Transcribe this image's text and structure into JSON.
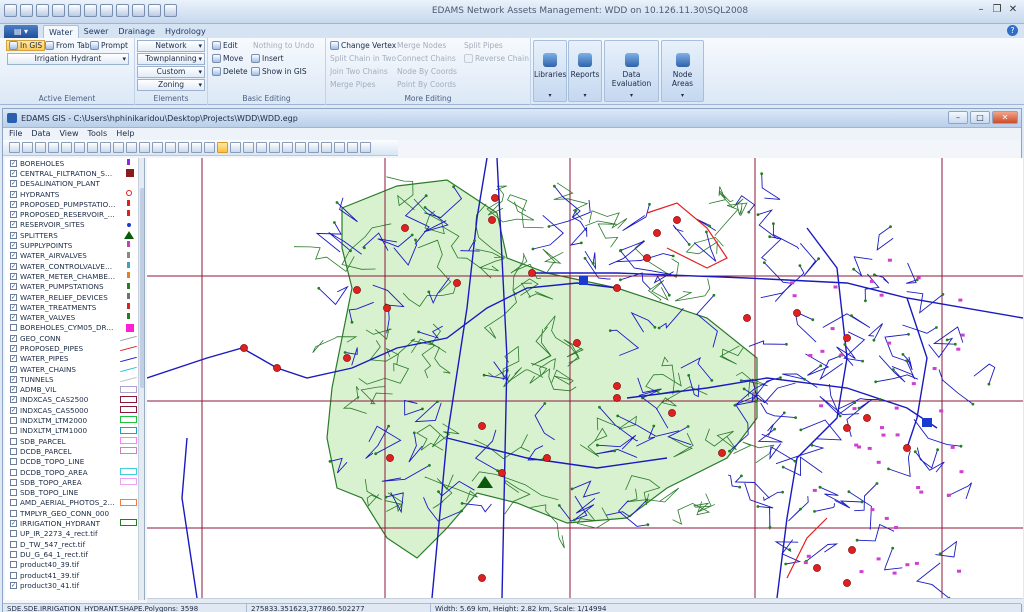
{
  "app": {
    "title": "EDAMS Network Assets Management: WDD on 10.126.11.30\\SQL2008"
  },
  "ribbon": {
    "tabs": [
      {
        "label": "Water"
      },
      {
        "label": "Sewer"
      },
      {
        "label": "Drainage"
      },
      {
        "label": "Hydrology"
      }
    ],
    "active_element": {
      "in_gis": "In GIS",
      "from_table": "From Table",
      "prompt": "Prompt",
      "selected": "Irrigation Hydrant",
      "group_label": "Active Element"
    },
    "elements": {
      "items": [
        "Network",
        "Townplanning",
        "Custom",
        "Zoning"
      ],
      "group_label": "Elements"
    },
    "basic_editing": {
      "edit": "Edit",
      "move": "Move",
      "delete": "Delete",
      "nothing_to_undo": "Nothing to Undo",
      "insert": "Insert",
      "show_in_gis": "Show in GIS",
      "group_label": "Basic Editing"
    },
    "more_editing": {
      "change_vertex": "Change Vertex",
      "split_chain_in_two": "Split Chain in Two",
      "join_two_chains": "Join Two Chains",
      "merge_pipes": "Merge Pipes",
      "merge_nodes": "Merge Nodes",
      "connect_chains": "Connect Chains",
      "node_by_coords": "Node By Coords",
      "point_by_coords": "Point By Coords",
      "split_pipes": "Split Pipes",
      "reverse_chain": "Reverse Chain",
      "group_label": "More Editing"
    },
    "big_buttons": [
      "Libraries",
      "Reports",
      "Data Evaluation",
      "Node Areas"
    ]
  },
  "gis": {
    "title": "EDAMS GIS - C:\\Users\\hphinikaridou\\Desktop\\Projects\\WDD\\WDD.egp",
    "menu": [
      "File",
      "Data",
      "View",
      "Tools",
      "Help"
    ]
  },
  "layers": [
    {
      "name": "BOREHOLES",
      "checked": true,
      "sym": "pin",
      "color": "#8a2be2"
    },
    {
      "name": "CENTRAL_FILTRATION_SYS...",
      "checked": true,
      "sym": "square",
      "color": "#8b1a1a"
    },
    {
      "name": "DESALINATION_PLANT",
      "checked": true,
      "sym": "none",
      "color": ""
    },
    {
      "name": "HYDRANTS",
      "checked": true,
      "sym": "circle",
      "color": "#e02020"
    },
    {
      "name": "PROPOSED_PUMPSTATIONS",
      "checked": true,
      "sym": "pin",
      "color": "#e02020"
    },
    {
      "name": "PROPOSED_RESERVOIR_SI...",
      "checked": true,
      "sym": "pin",
      "color": "#e02020"
    },
    {
      "name": "RESERVOIR_SITES",
      "checked": true,
      "sym": "dot",
      "color": "#1a3ad0"
    },
    {
      "name": "SPLITTERS",
      "checked": true,
      "sym": "triangle",
      "color": "#0a5a0a"
    },
    {
      "name": "SUPPLYPOINTS",
      "checked": true,
      "sym": "pin",
      "color": "#c040c0"
    },
    {
      "name": "WATER_AIRVALVES",
      "checked": true,
      "sym": "pin",
      "color": "#888888"
    },
    {
      "name": "WATER_CONTROLVALVEC...",
      "checked": true,
      "sym": "pin",
      "color": "#40a0c0"
    },
    {
      "name": "WATER_METER_CHAMBERS",
      "checked": true,
      "sym": "pin",
      "color": "#e08020"
    },
    {
      "name": "WATER_PUMPSTATIONS",
      "checked": true,
      "sym": "pin",
      "color": "#208020"
    },
    {
      "name": "WATER_RELIEF_DEVICES",
      "checked": true,
      "sym": "pin",
      "color": "#707070"
    },
    {
      "name": "WATER_TREATMENTS",
      "checked": true,
      "sym": "pin",
      "color": "#e02020"
    },
    {
      "name": "WATER_VALVES",
      "checked": true,
      "sym": "pin",
      "color": "#208020"
    },
    {
      "name": "BOREHOLES_CYM05_DRAFT",
      "checked": false,
      "sym": "square",
      "color": "#ff20d0"
    },
    {
      "name": "GEO_CONN",
      "checked": true,
      "sym": "line",
      "color": "#a0a0a0"
    },
    {
      "name": "PROPOSED_PIPES",
      "checked": true,
      "sym": "line",
      "color": "#e02020"
    },
    {
      "name": "WATER_PIPES",
      "checked": true,
      "sym": "line",
      "color": "#1a1ac0"
    },
    {
      "name": "WATER_CHAINS",
      "checked": true,
      "sym": "line",
      "color": "#20c0e0"
    },
    {
      "name": "TUNNELS",
      "checked": true,
      "sym": "line",
      "color": "#c0c0c0"
    },
    {
      "name": "ADMB_VIL",
      "checked": true,
      "sym": "rect",
      "color": "#b0a0d0"
    },
    {
      "name": "INDXCAS_CAS2500",
      "checked": true,
      "sym": "rect",
      "color": "#8b1a3a"
    },
    {
      "name": "INDXCAS_CAS5000",
      "checked": true,
      "sym": "rect",
      "color": "#8b1a3a"
    },
    {
      "name": "INDXLTM_LTM2000",
      "checked": false,
      "sym": "rect",
      "color": "#20c040"
    },
    {
      "name": "INDXLTM_LTM1000",
      "checked": false,
      "sym": "rect",
      "color": "#20a0c0"
    },
    {
      "name": "SDB_PARCEL",
      "checked": false,
      "sym": "rect",
      "color": "#ff80ff"
    },
    {
      "name": "DCDB_PARCEL",
      "checked": false,
      "sym": "rect",
      "color": "#d080c0"
    },
    {
      "name": "DCDB_TOPO_LINE",
      "checked": false,
      "sym": "none",
      "color": ""
    },
    {
      "name": "DCDB_TOPO_AREA",
      "checked": false,
      "sym": "rect",
      "color": "#40d0e0"
    },
    {
      "name": "SDB_TOPO_AREA",
      "checked": false,
      "sym": "rect",
      "color": "#f0a0f0"
    },
    {
      "name": "SDB_TOPO_LINE",
      "checked": false,
      "sym": "none",
      "color": ""
    },
    {
      "name": "AMD_AERIAL_PHOTOS_200...",
      "checked": false,
      "sym": "rect",
      "color": "#f08040"
    },
    {
      "name": "TMPLYR_GEO_CONN_000",
      "checked": false,
      "sym": "none",
      "color": ""
    },
    {
      "name": "IRRIGATION_HYDRANT",
      "checked": true,
      "sym": "rect",
      "color": "#208020"
    },
    {
      "name": "UP_IR_2273_4_rect.tif",
      "checked": false,
      "sym": "none",
      "color": ""
    },
    {
      "name": "D_TW_547_rect.tif",
      "checked": false,
      "sym": "none",
      "color": ""
    },
    {
      "name": "DU_G_64_1_rect.tif",
      "checked": false,
      "sym": "none",
      "color": ""
    },
    {
      "name": "product40_39.tif",
      "checked": false,
      "sym": "none",
      "color": ""
    },
    {
      "name": "product41_39.tif",
      "checked": false,
      "sym": "none",
      "color": ""
    },
    {
      "name": "product30_41.tif",
      "checked": true,
      "sym": "none",
      "color": ""
    }
  ],
  "status": {
    "layer": "SDE.SDE.IRRIGATION_HYDRANT.SHAPE.Polygons: 3598",
    "coords": "275833.351623,377860.502277",
    "extent": "Width: 5.69 km, Height: 2.82 km, Scale: 1/14994"
  },
  "colors": {
    "grid": "#8b1a3a",
    "parcel_fill": "#d8f2d0",
    "parcel_line": "#2a7a2a",
    "pipe": "#1a1ac0",
    "proposed_pipe": "#e02020",
    "hydrant": "#e02020",
    "supply": "#d040d0"
  }
}
